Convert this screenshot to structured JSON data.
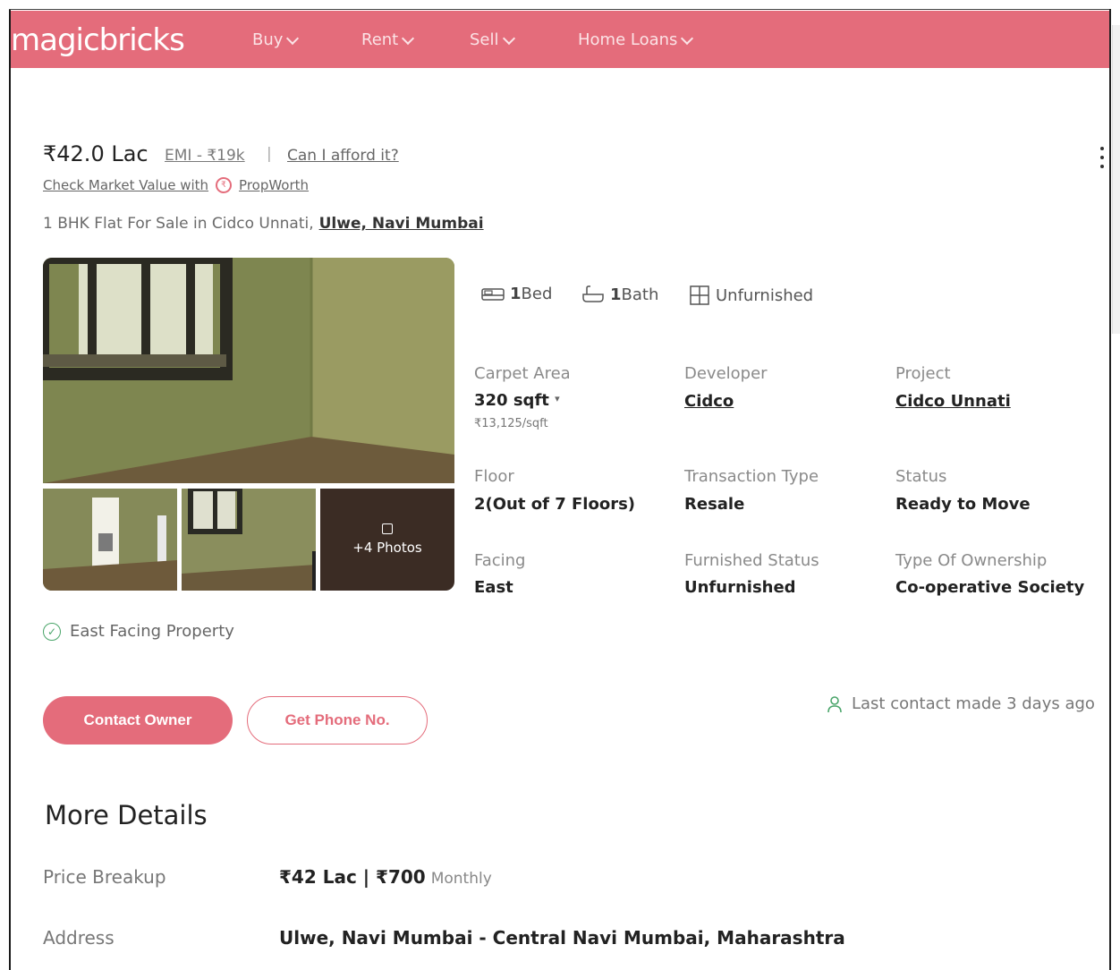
{
  "header": {
    "logo": "magicbricks",
    "nav": [
      {
        "label": "Buy"
      },
      {
        "label": "Rent"
      },
      {
        "label": "Sell"
      },
      {
        "label": "Home Loans"
      }
    ]
  },
  "summary": {
    "price": "₹42.0 Lac",
    "emi": "EMI - ₹19k",
    "separator": "|",
    "afford": "Can I afford it?",
    "market_value": "Check Market Value with",
    "propworth": "PropWorth",
    "title": "1 BHK Flat For Sale in Cidco Unnati,",
    "location": "Ulwe, Navi Mumbai"
  },
  "gallery": {
    "more_photos": "+4 Photos"
  },
  "amenities": [
    {
      "icon": "bed-icon",
      "count": "1",
      "label": "Bed"
    },
    {
      "icon": "bath-icon",
      "count": "1",
      "label": "Bath"
    },
    {
      "icon": "furnishing-icon",
      "count": "",
      "label": "Unfurnished"
    }
  ],
  "details": {
    "carpet_area": {
      "label": "Carpet Area",
      "value": "320 sqft",
      "sub": "₹13,125/sqft"
    },
    "developer": {
      "label": "Developer",
      "value": "Cidco"
    },
    "project": {
      "label": "Project",
      "value": "Cidco Unnati"
    },
    "floor": {
      "label": "Floor",
      "value": "2(Out of 7 Floors)"
    },
    "transaction": {
      "label": "Transaction Type",
      "value": "Resale"
    },
    "status": {
      "label": "Status",
      "value": "Ready to Move"
    },
    "facing": {
      "label": "Facing",
      "value": "East"
    },
    "furnished": {
      "label": "Furnished Status",
      "value": "Unfurnished"
    },
    "ownership": {
      "label": "Type Of Ownership",
      "value": "Co-operative Society"
    }
  },
  "highlight": "East Facing Property",
  "actions": {
    "contact": "Contact Owner",
    "phone": "Get Phone No.",
    "last_contact": "Last contact made 3 days ago"
  },
  "more_details": {
    "heading": "More Details",
    "price_breakup_label": "Price Breakup",
    "price_breakup_value": "₹42 Lac | ₹700",
    "price_breakup_unit": "Monthly",
    "address_label": "Address",
    "address_value": "Ulwe, Navi Mumbai - Central Navi Mumbai, Maharashtra"
  },
  "colors": {
    "brand": "#e46c7b",
    "success": "#4aa56a"
  }
}
